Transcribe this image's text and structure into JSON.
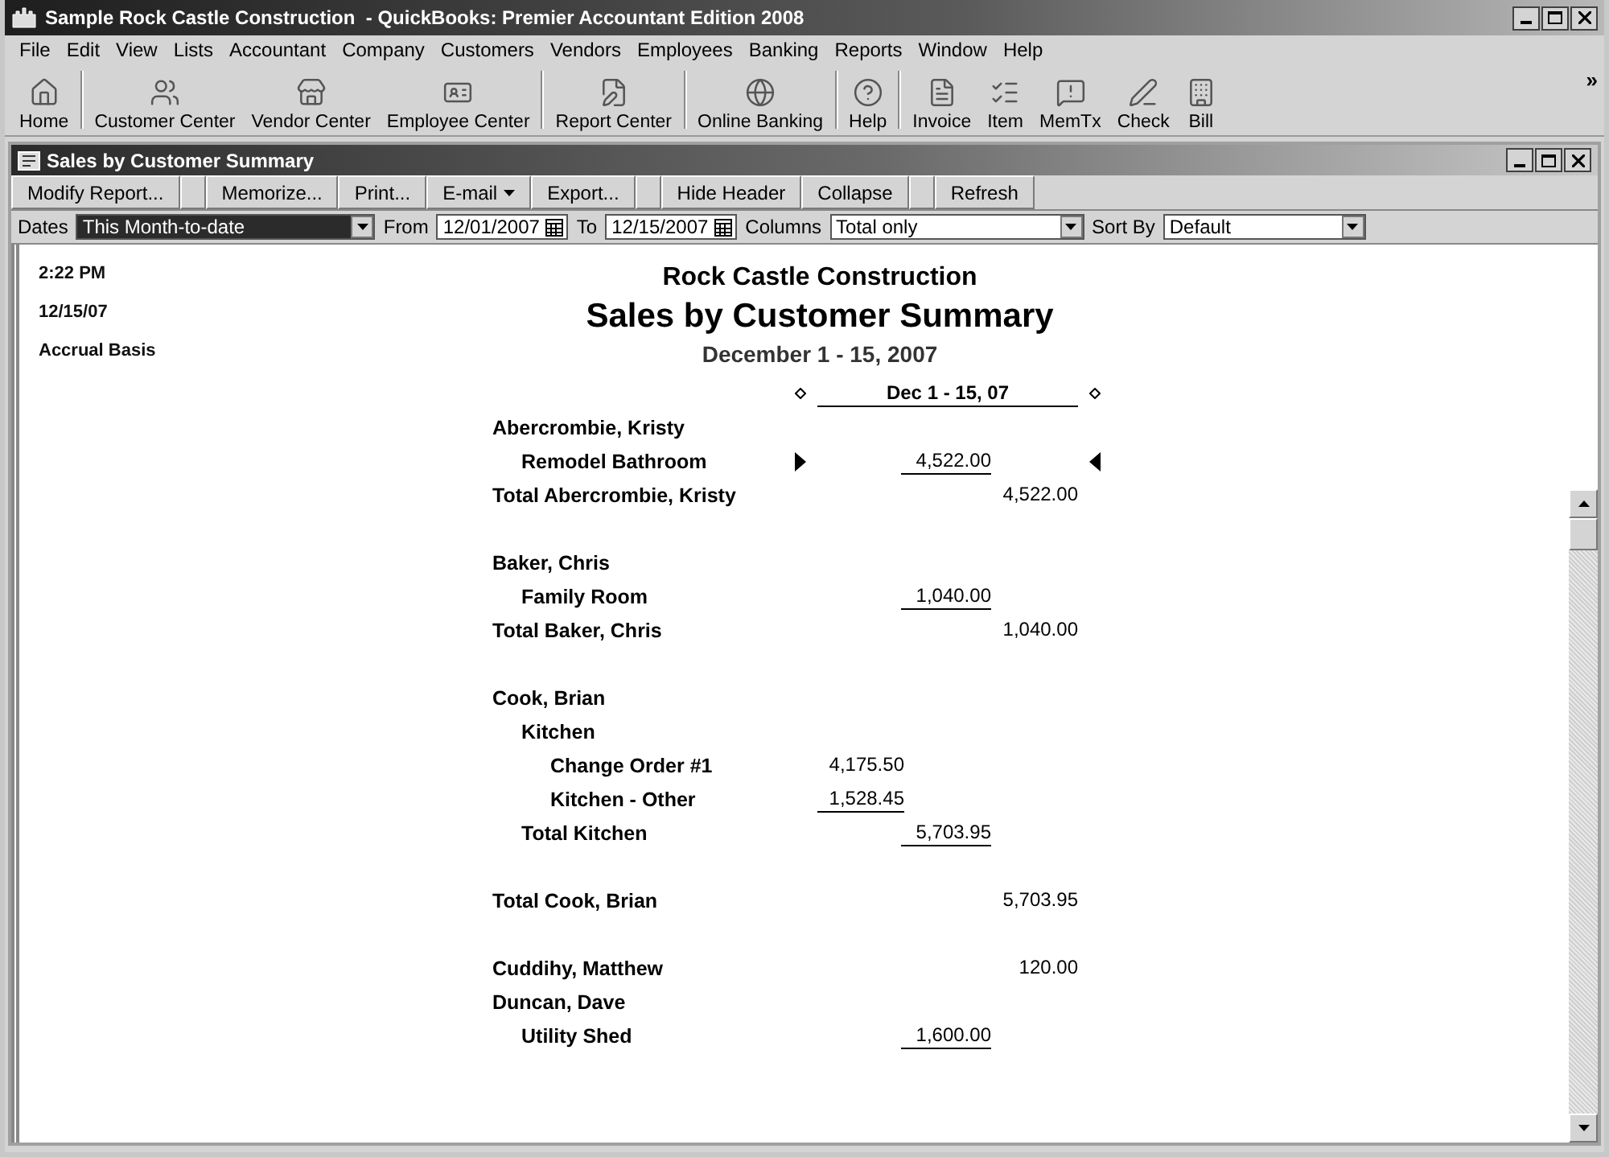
{
  "window": {
    "title": "Sample Rock Castle Construction  - QuickBooks: Premier Accountant Edition 2008"
  },
  "menu": [
    "File",
    "Edit",
    "View",
    "Lists",
    "Accountant",
    "Company",
    "Customers",
    "Vendors",
    "Employees",
    "Banking",
    "Reports",
    "Window",
    "Help"
  ],
  "toolbar": {
    "groups": [
      [
        {
          "label": "Home"
        }
      ],
      [
        {
          "label": "Customer Center"
        },
        {
          "label": "Vendor Center"
        },
        {
          "label": "Employee Center"
        }
      ],
      [
        {
          "label": "Report Center"
        }
      ],
      [
        {
          "label": "Online Banking"
        }
      ],
      [
        {
          "label": "Help"
        }
      ],
      [
        {
          "label": "Invoice"
        },
        {
          "label": "Item"
        },
        {
          "label": "MemTx"
        },
        {
          "label": "Check"
        },
        {
          "label": "Bill"
        }
      ]
    ],
    "more": "»"
  },
  "report_window": {
    "title": "Sales by Customer Summary",
    "button_groups": [
      [
        {
          "label": "Modify Report...",
          "kind": "button"
        }
      ],
      [
        {
          "label": "Memorize...",
          "kind": "button"
        },
        {
          "label": "Print...",
          "kind": "button"
        },
        {
          "label": "E-mail",
          "kind": "menu"
        },
        {
          "label": "Export...",
          "kind": "button"
        }
      ],
      [
        {
          "label": "Hide Header",
          "kind": "button"
        },
        {
          "label": "Collapse",
          "kind": "button"
        }
      ],
      [
        {
          "label": "Refresh",
          "kind": "button"
        }
      ]
    ],
    "filters": {
      "dates": {
        "label": "Dates",
        "value": "This Month-to-date"
      },
      "from": {
        "label": "From",
        "value": "12/01/2007"
      },
      "to": {
        "label": "To",
        "value": "12/15/2007"
      },
      "columns": {
        "label": "Columns",
        "value": "Total only"
      },
      "sort_by": {
        "label": "Sort By",
        "value": "Default"
      }
    },
    "report": {
      "time": "2:22 PM",
      "date": "12/15/07",
      "basis": "Accrual Basis",
      "company": "Rock Castle Construction",
      "title": "Sales by Customer Summary",
      "period": "December 1 - 15, 2007",
      "column_header": "Dec 1 - 15, 07",
      "rows": [
        {
          "label": "Abercrombie, Kristy",
          "selected": false,
          "children": [
            {
              "label": "Remodel Bathroom",
              "amount": "4,522.00",
              "selected": true
            }
          ],
          "total_label": "Total Abercrombie, Kristy",
          "total_amount": "4,522.00"
        },
        {
          "label": "Baker, Chris",
          "selected": false,
          "children": [
            {
              "label": "Family Room",
              "amount": "1,040.00",
              "selected": false
            }
          ],
          "total_label": "Total Baker, Chris",
          "total_amount": "1,040.00"
        },
        {
          "label": "Cook, Brian",
          "selected": false,
          "children": [
            {
              "label": "Kitchen",
              "selected": false,
              "children": [
                {
                  "label": "Change Order #1",
                  "amount": "4,175.50",
                  "selected": false
                },
                {
                  "label": "Kitchen - Other",
                  "amount": "1,528.45",
                  "selected": false
                }
              ],
              "total_label": "Total Kitchen",
              "total_amount": "5,703.95"
            }
          ],
          "total_label": "Total Cook, Brian",
          "total_amount": "5,703.95"
        },
        {
          "label": "Cuddihy, Matthew",
          "amount": "120.00",
          "selected": false
        },
        {
          "label": "Duncan, Dave",
          "selected": false,
          "children": [
            {
              "label": "Utility Shed",
              "amount": "1,600.00",
              "selected": false
            }
          ]
        }
      ]
    }
  }
}
